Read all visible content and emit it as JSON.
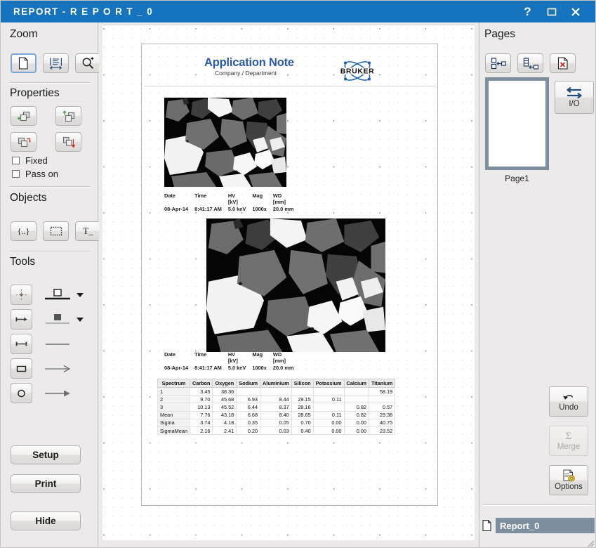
{
  "window": {
    "title": "REPORT  -  R E P O R T _ 0",
    "help_label": "?",
    "maximize_label": "maximize",
    "close_label": "✕"
  },
  "left_panel": {
    "zoom": {
      "title": "Zoom",
      "buttons": [
        {
          "name": "zoom-fit-page",
          "icon": "page-icon"
        },
        {
          "name": "zoom-fit-width",
          "icon": "fit-width-icon"
        },
        {
          "name": "zoom-in",
          "icon": "magnifier-plus-icon"
        }
      ]
    },
    "properties": {
      "title": "Properties",
      "buttons": [
        {
          "name": "property-add-front",
          "icon": "add-object-front-icon"
        },
        {
          "name": "property-move-up",
          "icon": "move-up-icon"
        },
        {
          "name": "property-copy-right",
          "icon": "copy-right-icon"
        },
        {
          "name": "property-move-down",
          "icon": "move-down-icon"
        }
      ],
      "checkboxes": [
        {
          "label": "Fixed",
          "checked": false
        },
        {
          "label": "Pass on",
          "checked": false
        }
      ]
    },
    "objects": {
      "title": "Objects",
      "buttons": [
        {
          "name": "object-placeholder",
          "icon": "braces-icon",
          "glyph": "{..}"
        },
        {
          "name": "object-frame",
          "icon": "dotted-frame-icon"
        },
        {
          "name": "object-text",
          "icon": "text-icon",
          "glyph": "T_"
        }
      ]
    },
    "tools": {
      "title": "Tools",
      "rows": [
        {
          "name": "tool-point",
          "icon": "crosshair-icon",
          "style": "thick-line-with-square",
          "has_dropdown": true
        },
        {
          "name": "tool-arrow",
          "icon": "arrow-line-icon",
          "style": "thin-line-with-filled-square",
          "has_dropdown": true
        },
        {
          "name": "tool-dimension",
          "icon": "measure-icon",
          "style": "plain-line",
          "has_dropdown": false
        },
        {
          "name": "tool-rectangle",
          "icon": "rectangle-icon",
          "style": "open-arrow",
          "has_dropdown": false
        },
        {
          "name": "tool-ellipse",
          "icon": "ellipse-icon",
          "style": "solid-arrow",
          "has_dropdown": false
        }
      ]
    },
    "actions": {
      "setup": "Setup",
      "print": "Print",
      "hide": "Hide"
    }
  },
  "right_panel": {
    "pages": {
      "title": "Pages",
      "buttons": [
        {
          "name": "page-insert-before",
          "icon": "insert-page-before-icon"
        },
        {
          "name": "page-insert-after",
          "icon": "insert-page-after-icon"
        },
        {
          "name": "page-delete",
          "icon": "delete-page-icon"
        }
      ],
      "thumbnail_label": "Page1"
    },
    "io_button": {
      "label": "I/O",
      "icon": "swap-arrows-icon"
    },
    "side_buttons": [
      {
        "name": "undo-button",
        "label": "Undo",
        "icon": "undo-arrow-icon",
        "enabled": true
      },
      {
        "name": "merge-button",
        "label": "Merge",
        "icon": "sigma-icon",
        "enabled": false
      },
      {
        "name": "options-button",
        "label": "Options",
        "icon": "options-gear-icon",
        "enabled": true
      }
    ],
    "report_item": {
      "label": "Report_0",
      "icon": "document-icon"
    }
  },
  "document": {
    "title": "Application Note",
    "subtitle": "Company / Department",
    "logo_text": "BRUKER",
    "image_info_headers": [
      "Date",
      "Time",
      "HV\n[kV]",
      "Mag",
      "WD\n[mm]"
    ],
    "image_info_values": [
      "08-Apr-14",
      "8:41:17 AM",
      "5.0 keV",
      "1000x",
      "20.0 mm"
    ],
    "spectrum_table": {
      "headers": [
        "Spectrum",
        "Carbon",
        "Oxygen",
        "Sodium",
        "Aluminium",
        "Silicon",
        "Potassium",
        "Calcium",
        "Titanium"
      ],
      "rows": [
        [
          "1",
          "3.45",
          "38.36",
          "",
          "",
          "",
          "",
          "",
          "58.19"
        ],
        [
          "2",
          "9.70",
          "45.68",
          "6.93",
          "8.44",
          "29.15",
          "0.11",
          "",
          ""
        ],
        [
          "3",
          "10.13",
          "45.52",
          "6.44",
          "8.37",
          "28.16",
          "",
          "0.82",
          "0.57"
        ],
        [
          "Mean",
          "7.76",
          "43.18",
          "6.68",
          "8.40",
          "28.65",
          "0.11",
          "0.82",
          "29.38"
        ],
        [
          "Sigma",
          "3.74",
          "4.18",
          "0.35",
          "0.05",
          "0.70",
          "0.00",
          "0.00",
          "40.75"
        ],
        [
          "SigmaMean",
          "2.16",
          "2.41",
          "0.20",
          "0.03",
          "0.40",
          "0.00",
          "0.00",
          "23.52"
        ]
      ]
    }
  },
  "colors": {
    "titlebar": "#1673bd",
    "panel": "#eceaea",
    "doc_title": "#2b5aa8",
    "logo": "#1a62a8",
    "selection": "#7d8f9e"
  }
}
